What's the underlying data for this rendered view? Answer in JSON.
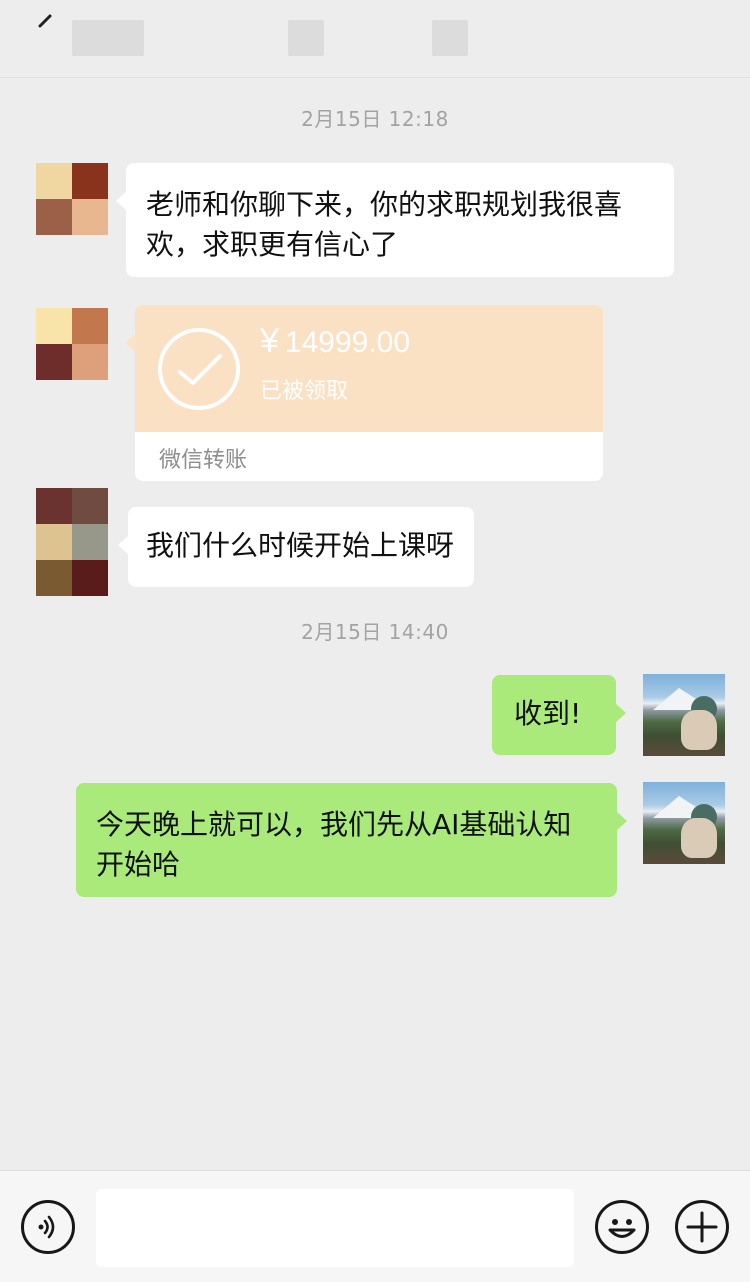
{
  "header": {
    "back_icon": "chevron-left-icon"
  },
  "timestamps": [
    "2月15日 12:18",
    "2月15日 14:40"
  ],
  "messages": [
    {
      "side": "left",
      "type": "text",
      "text": "老师和你聊下来，你的求职规划我很喜欢，求职更有信心了"
    },
    {
      "side": "left",
      "type": "transfer",
      "currency": "¥",
      "amount": "14999.00",
      "status": "已被领取",
      "label": "微信转账"
    },
    {
      "side": "left",
      "type": "text",
      "text": "我们什么时候开始上课呀"
    },
    {
      "side": "right",
      "type": "text",
      "text": "收到!"
    },
    {
      "side": "right",
      "type": "text",
      "text": "今天晚上就可以，我们先从AI基础认知开始哈"
    }
  ],
  "input_bar": {
    "voice_icon": "voice-icon",
    "input_value": "",
    "emoji_icon": "emoji-icon",
    "plus_icon": "plus-icon"
  },
  "colors": {
    "background": "#ededed",
    "bubble_left": "#ffffff",
    "bubble_right": "#a9ea7a",
    "transfer_card": "#fbe1c3",
    "timestamp_text": "#a3a3a3"
  }
}
